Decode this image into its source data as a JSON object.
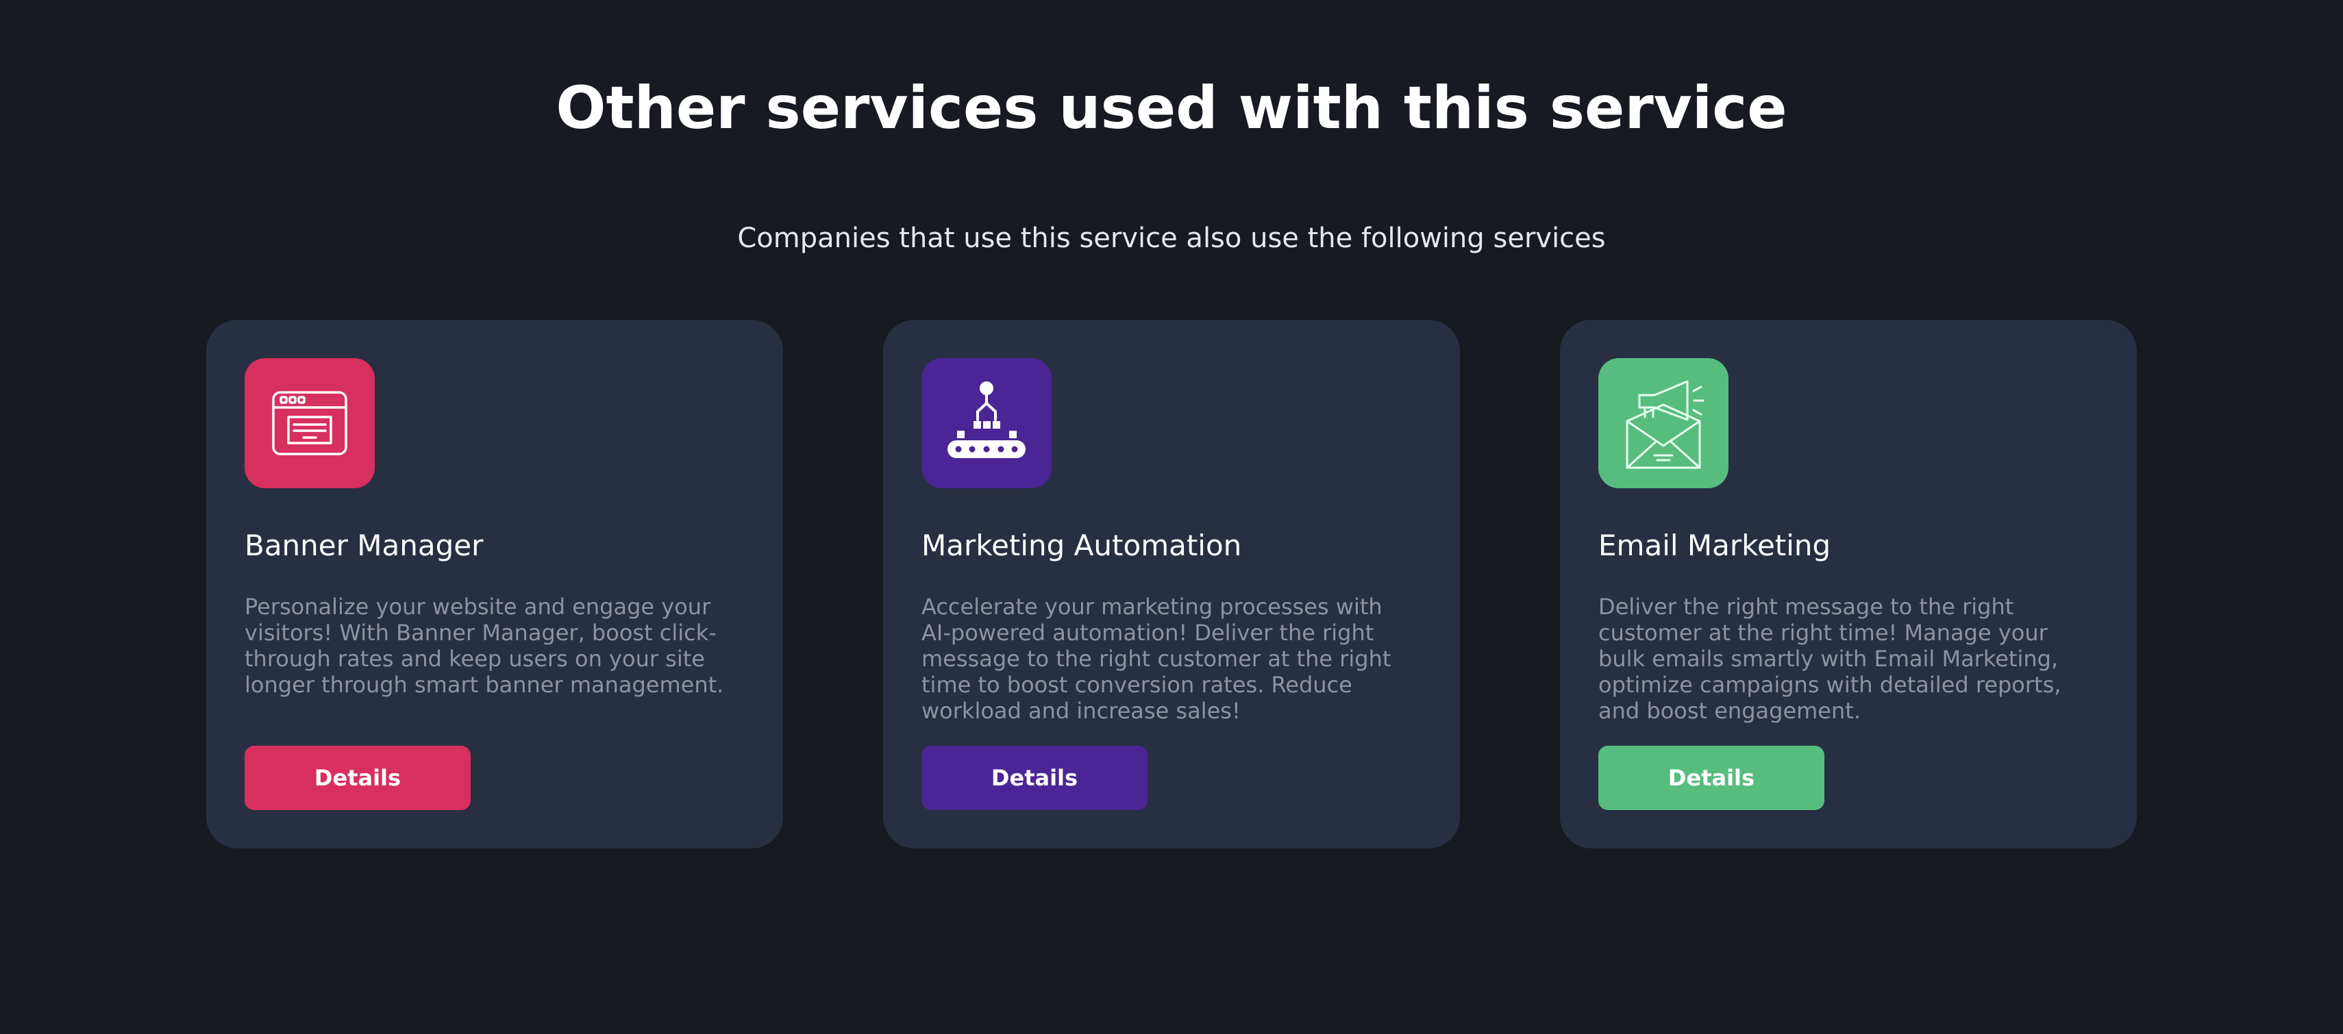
{
  "section": {
    "title": "Other services used with this service",
    "subtitle": "Companies that use this service also use the following services"
  },
  "cards": [
    {
      "icon": "browser-banner-icon",
      "accent": "#d72f5f",
      "title": "Banner Manager",
      "description": "Personalize your website and engage your visitors! With Banner Manager, boost click-through rates and keep users on your site longer through smart banner management.",
      "button_label": "Details"
    },
    {
      "icon": "automation-conveyor-icon",
      "accent": "#4b2595",
      "title": "Marketing Automation",
      "description": "Accelerate your marketing processes with AI-powered automation! Deliver the right message to the right customer at the right time to boost conversion rates. Reduce workload and increase sales!",
      "button_label": "Details"
    },
    {
      "icon": "megaphone-envelope-icon",
      "accent": "#57bd7f",
      "title": "Email Marketing",
      "description": "Deliver the right message to the right customer at the right time! Manage your bulk emails smartly with Email Marketing, optimize campaigns with detailed reports, and boost engagement.",
      "button_label": "Details"
    }
  ]
}
